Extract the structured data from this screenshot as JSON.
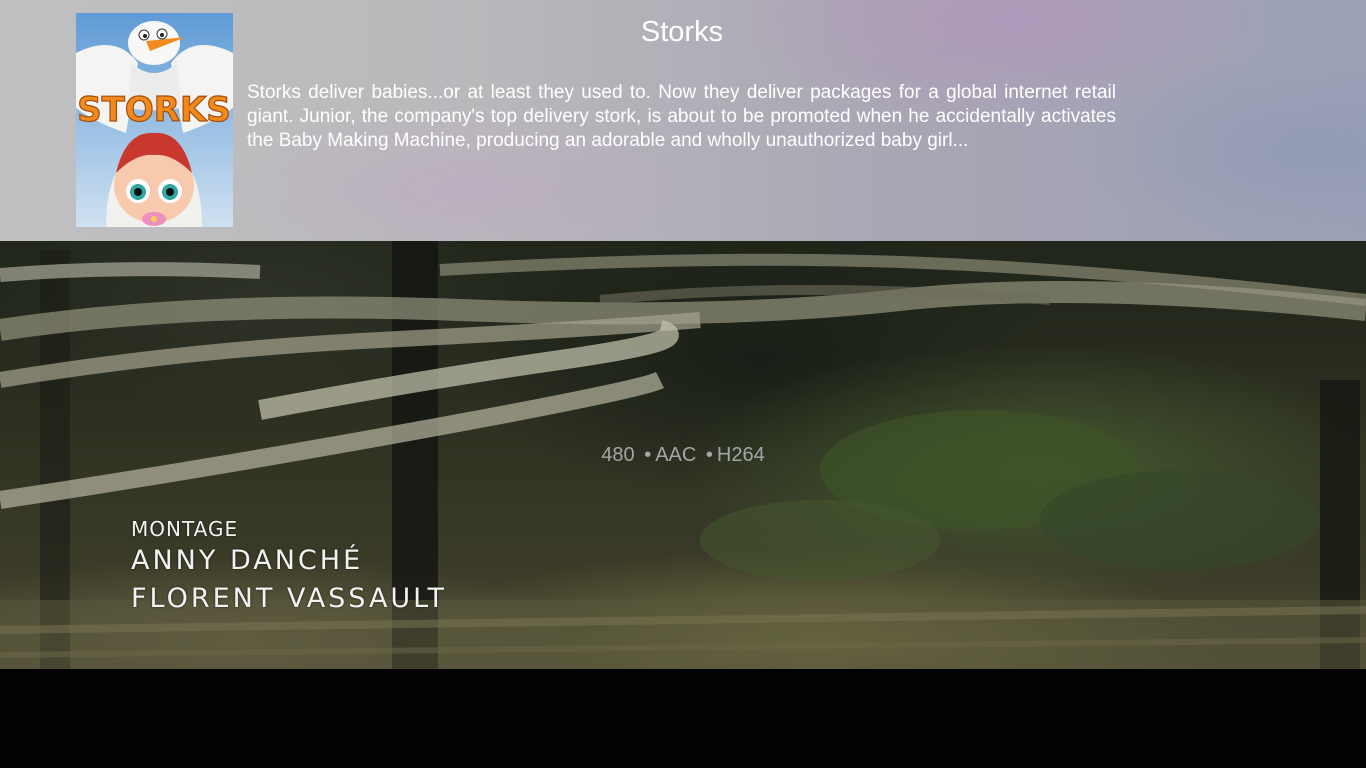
{
  "movie": {
    "title": "Storks",
    "description": "Storks deliver babies...or at least they used to. Now they deliver packages for a global internet retail giant. Junior, the company's top delivery stork, is about to be promoted when he accidentally activates the Baby Making Machine, producing an adorable and wholly unauthorized baby girl...",
    "poster_text": "STORKS"
  },
  "stream": {
    "resolution": "480",
    "audio": "AAC",
    "video": "H264",
    "separator": "•"
  },
  "video_credits": {
    "role": "MONTAGE",
    "names": [
      "ANNY DANCHÉ",
      "FLORENT VASSAULT"
    ]
  },
  "colors": {
    "overlay_text": "#ffffff",
    "stream_text": "#a4a6a6",
    "poster_title": "#f08a1c"
  }
}
